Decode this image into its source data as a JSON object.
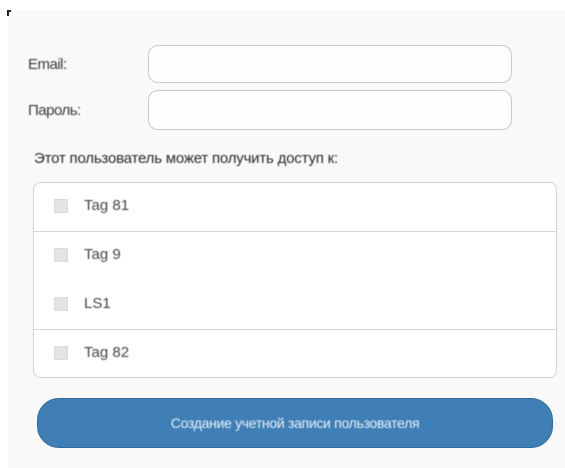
{
  "form": {
    "email_label": "Email:",
    "email_value": "",
    "password_label": "Пароль:",
    "password_value": ""
  },
  "access": {
    "title": "Этот пользователь может получить доступ к:",
    "items": [
      {
        "label": "Tag 81",
        "checked": false
      },
      {
        "label": "Tag 9",
        "checked": false
      },
      {
        "label": "LS1",
        "checked": false
      },
      {
        "label": "Tag 82",
        "checked": false
      }
    ]
  },
  "submit": {
    "label": "Создание учетной записи пользователя"
  },
  "colors": {
    "button": "#3f7fb6",
    "background": "#f9f9f9"
  }
}
